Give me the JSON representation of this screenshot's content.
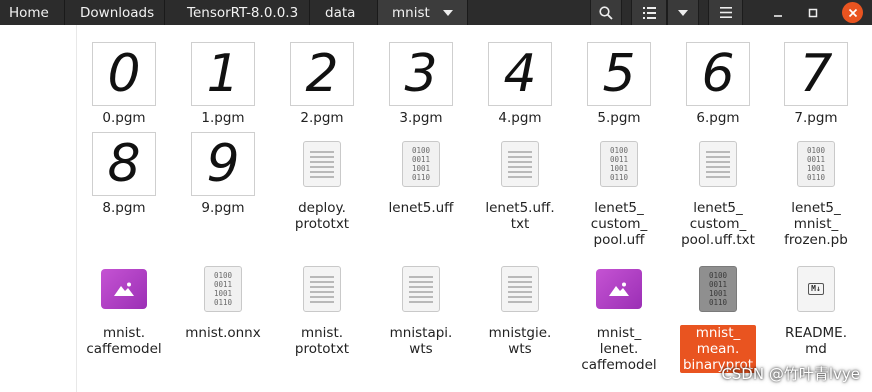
{
  "breadcrumbs": [
    "Home",
    "Downloads",
    "TensorRT-8.0.0.3",
    "data",
    "mnist"
  ],
  "colors": {
    "toolbar": "#2c2c2c",
    "selection": "#e95420",
    "close": "#e95420"
  },
  "toolbar": {
    "search_icon": "search-icon",
    "view_icon": "list-view-icon",
    "sort_icon": "chevron-down-icon",
    "menu_icon": "hamburger-menu-icon"
  },
  "window": {
    "minimize": "–",
    "maximize": "□",
    "close": "×"
  },
  "files": [
    {
      "name": "0.pgm",
      "type": "image",
      "glyph": "0"
    },
    {
      "name": "1.pgm",
      "type": "image",
      "glyph": "1"
    },
    {
      "name": "2.pgm",
      "type": "image",
      "glyph": "2"
    },
    {
      "name": "3.pgm",
      "type": "image",
      "glyph": "3"
    },
    {
      "name": "4.pgm",
      "type": "image",
      "glyph": "4"
    },
    {
      "name": "5.pgm",
      "type": "image",
      "glyph": "5"
    },
    {
      "name": "6.pgm",
      "type": "image",
      "glyph": "6"
    },
    {
      "name": "7.pgm",
      "type": "image",
      "glyph": "7"
    },
    {
      "name": "8.pgm",
      "type": "image",
      "glyph": "8"
    },
    {
      "name": "9.pgm",
      "type": "image",
      "glyph": "9"
    },
    {
      "name": "deploy.\nprototxt",
      "type": "text"
    },
    {
      "name": "lenet5.uff",
      "type": "binary"
    },
    {
      "name": "lenet5.uff.\ntxt",
      "type": "text"
    },
    {
      "name": "lenet5_\ncustom_\npool.uff",
      "type": "binary"
    },
    {
      "name": "lenet5_\ncustom_\npool.uff.txt",
      "type": "text"
    },
    {
      "name": "lenet5_\nmnist_\nfrozen.pb",
      "type": "binary"
    },
    {
      "name": "mnist.\ncaffemodel",
      "type": "caffemodel"
    },
    {
      "name": "mnist.onnx",
      "type": "binary"
    },
    {
      "name": "mnist.\nprototxt",
      "type": "text"
    },
    {
      "name": "mnistapi.\nwts",
      "type": "text"
    },
    {
      "name": "mnistgie.\nwts",
      "type": "text"
    },
    {
      "name": "mnist_\nlenet.\ncaffemodel",
      "type": "caffemodel"
    },
    {
      "name": "mnist_\nmean.\nbinaryprot",
      "type": "binary",
      "selected": true
    },
    {
      "name": "README.\nmd",
      "type": "markdown"
    }
  ],
  "binary_bits": "0100\n0011\n1001\n0110",
  "markdown_badge": "M↓",
  "watermark": "CSDN @竹叶青lvye"
}
